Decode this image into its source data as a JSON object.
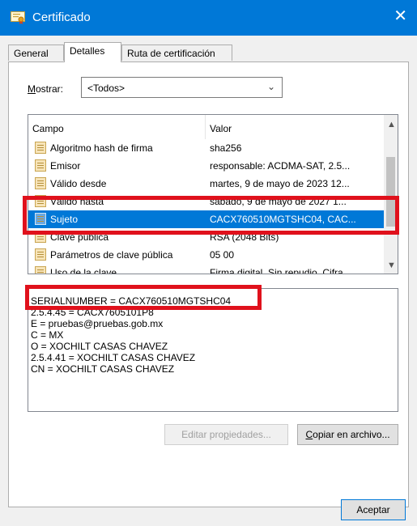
{
  "window": {
    "title": "Certificado",
    "close_glyph": "✕"
  },
  "tabs": [
    {
      "label": "General",
      "active": false
    },
    {
      "label": "Detalles",
      "active": true
    },
    {
      "label": "Ruta de certificación",
      "active": false
    }
  ],
  "show": {
    "label_accel": "M",
    "label_rest": "ostrar:",
    "value": "<Todos>"
  },
  "columns": {
    "field": "Campo",
    "value": "Valor"
  },
  "rows": [
    {
      "field": "Algoritmo hash de firma",
      "value": "sha256"
    },
    {
      "field": "Emisor",
      "value": "responsable: ACDMA-SAT, 2.5..."
    },
    {
      "field": "Válido desde",
      "value": "martes, 9 de mayo de 2023 12..."
    },
    {
      "field": "Válido hasta",
      "value": "sábado, 9 de mayo de 2027 1..."
    },
    {
      "field": "Sujeto",
      "value": "CACX760510MGTSHC04, CAC...",
      "selected": true
    },
    {
      "field": "Clave pública",
      "value": "RSA (2048 Bits)"
    },
    {
      "field": "Parámetros de clave pública",
      "value": "05 00"
    },
    {
      "field": "Uso de la clave",
      "value": "Firma digital, Sin repudio, Cifra..."
    }
  ],
  "details": [
    "SERIALNUMBER = CACX760510MGTSHC04",
    "2.5.4.45 = CACX7605101P8",
    "E = pruebas@pruebas.gob.mx",
    "C = MX",
    "O = XOCHILT CASAS CHAVEZ",
    "2.5.4.41 = XOCHILT CASAS CHAVEZ",
    "CN = XOCHILT CASAS CHAVEZ"
  ],
  "buttons": {
    "edit_pre": "Editar pro",
    "edit_accel": "p",
    "edit_post": "iedades...",
    "copy_accel": "C",
    "copy_post": "opiar en archivo...",
    "ok": "Aceptar"
  },
  "colors": {
    "titlebar": "#0078d7",
    "selection": "#0078d7",
    "highlight_box": "#e0111c"
  },
  "icons": [
    "certificate-icon",
    "close-icon",
    "chevron-down-icon",
    "field-icon"
  ]
}
